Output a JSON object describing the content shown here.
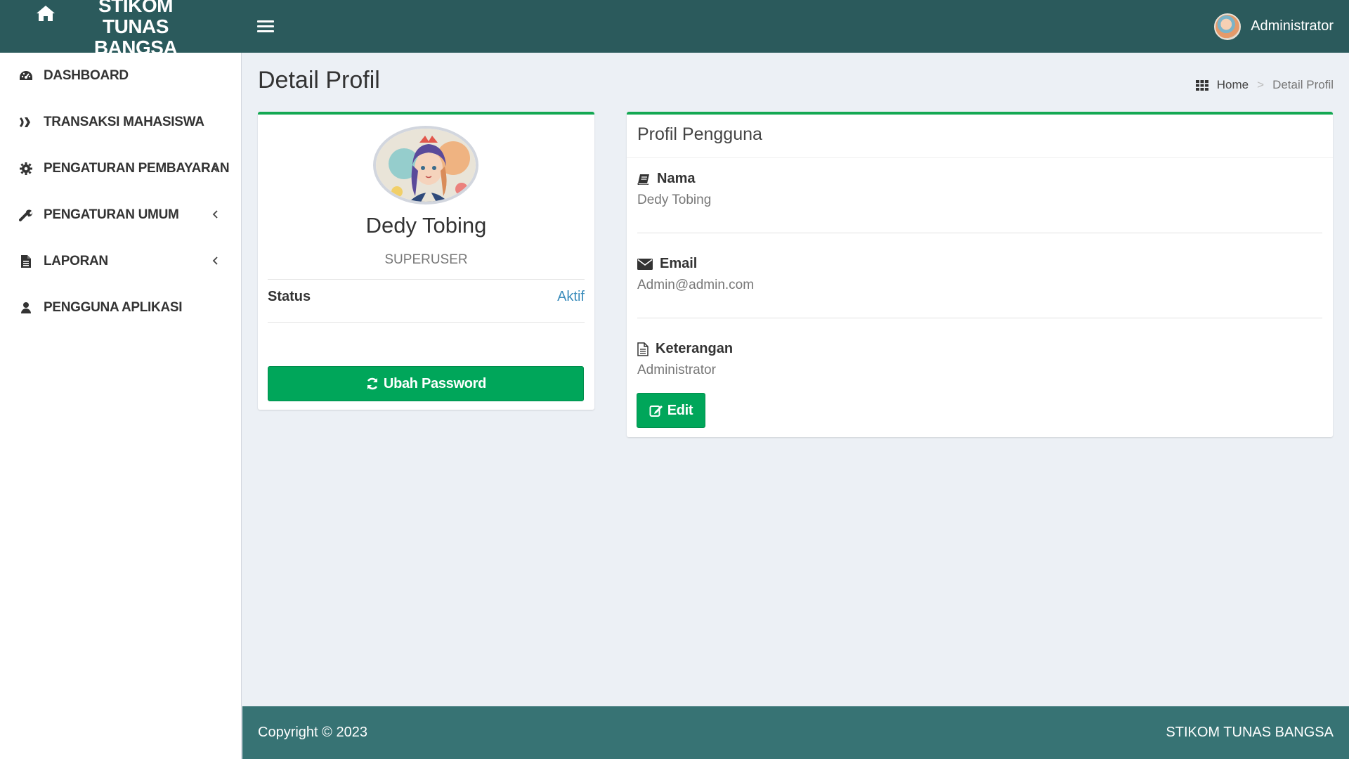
{
  "header": {
    "brand": "STIKOM TUNAS BANGSA",
    "user_name": "Administrator"
  },
  "sidebar": {
    "items": [
      {
        "label": "DASHBOARD",
        "icon": "dashboard-icon"
      },
      {
        "label": "TRANSAKSI MAHASISWA",
        "icon": "transaction-icon"
      },
      {
        "label": "PENGATURAN PEMBAYARAN",
        "icon": "gear-icon",
        "has_submenu": true
      },
      {
        "label": "PENGATURAN UMUM",
        "icon": "wrench-icon",
        "has_submenu": true
      },
      {
        "label": "LAPORAN",
        "icon": "file-icon",
        "has_submenu": true
      },
      {
        "label": "PENGGUNA APLIKASI",
        "icon": "user-icon"
      }
    ]
  },
  "page": {
    "title": "Detail Profil",
    "breadcrumb": {
      "home": "Home",
      "separator": ">",
      "current": "Detail Profil"
    }
  },
  "profile_card": {
    "name": "Dedy Tobing",
    "role": "SUPERUSER",
    "status_label": "Status",
    "status_value": "Aktif",
    "button_label": "Ubah Password"
  },
  "profile_detail": {
    "title": "Profil Pengguna",
    "fields": [
      {
        "label": "Nama",
        "value": "Dedy Tobing",
        "icon": "book-icon"
      },
      {
        "label": "Email",
        "value": "Admin@admin.com",
        "icon": "envelope-icon"
      },
      {
        "label": "Keterangan",
        "value": "Administrator",
        "icon": "document-icon"
      }
    ],
    "edit_label": "Edit"
  },
  "footer": {
    "copyright": "Copyright © 2023",
    "org": "STIKOM TUNAS BANGSA"
  },
  "colors": {
    "header_bg": "#2b5a5c",
    "footer_bg": "#377374",
    "accent_green": "#00a65a",
    "box_border": "#13a852",
    "link_blue": "#3c8dbc",
    "content_bg": "#ecf0f5"
  }
}
